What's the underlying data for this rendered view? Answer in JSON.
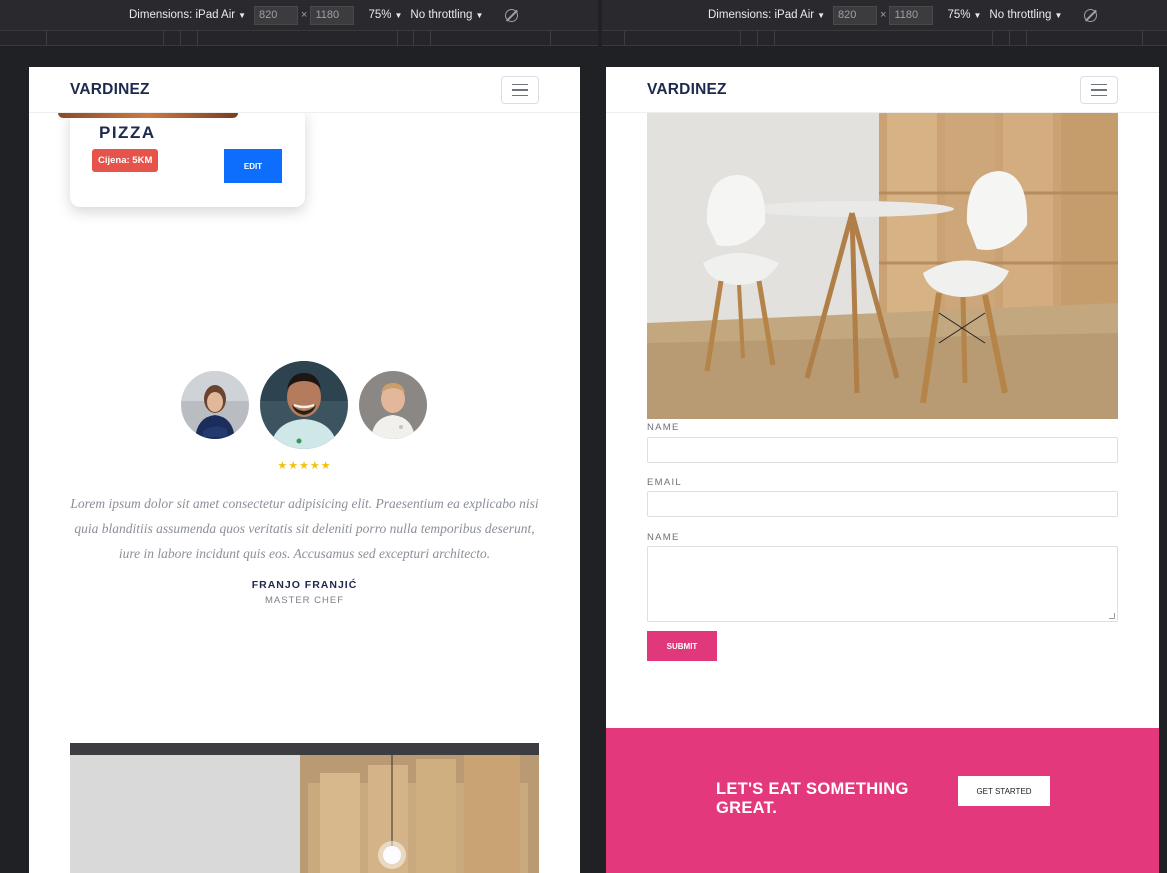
{
  "devtools": {
    "dimensions_label": "Dimensions: iPad Air",
    "width": "820",
    "times": "×",
    "height": "1180",
    "zoom": "75%",
    "throttling": "No throttling",
    "caret": "▼"
  },
  "navbar": {
    "brand": "VARDINEZ"
  },
  "left": {
    "card": {
      "title": "PIZZA",
      "price": "Cijena: 5KM",
      "edit_label": "EDIT"
    },
    "testimonial": {
      "stars": "★★★★★",
      "rating": 5,
      "quote": "Lorem ipsum dolor sit amet consectetur adipisicing elit. Praesentium ea explicabo nisi quia blanditiis assumenda quos veritatis sit deleniti porro nulla temporibus deserunt, iure in labore incidunt quis eos. Accusamus sed excepturi architecto.",
      "author": "FRANJO FRANJIĆ",
      "role": "MASTER CHEF"
    }
  },
  "right": {
    "form": {
      "name_label": "NAME",
      "email_label": "EMAIL",
      "message_label": "NAME",
      "submit_label": "SUBMIT"
    },
    "cta": {
      "text": "LET'S EAT SOMETHING GREAT.",
      "button_label": "GET STARTED"
    }
  },
  "colors": {
    "brand": "#1d2a4d",
    "primary_button": "#0d6efd",
    "accent_pink": "#e4387c",
    "badge_red": "#e5534b",
    "star": "#f4c20d"
  }
}
